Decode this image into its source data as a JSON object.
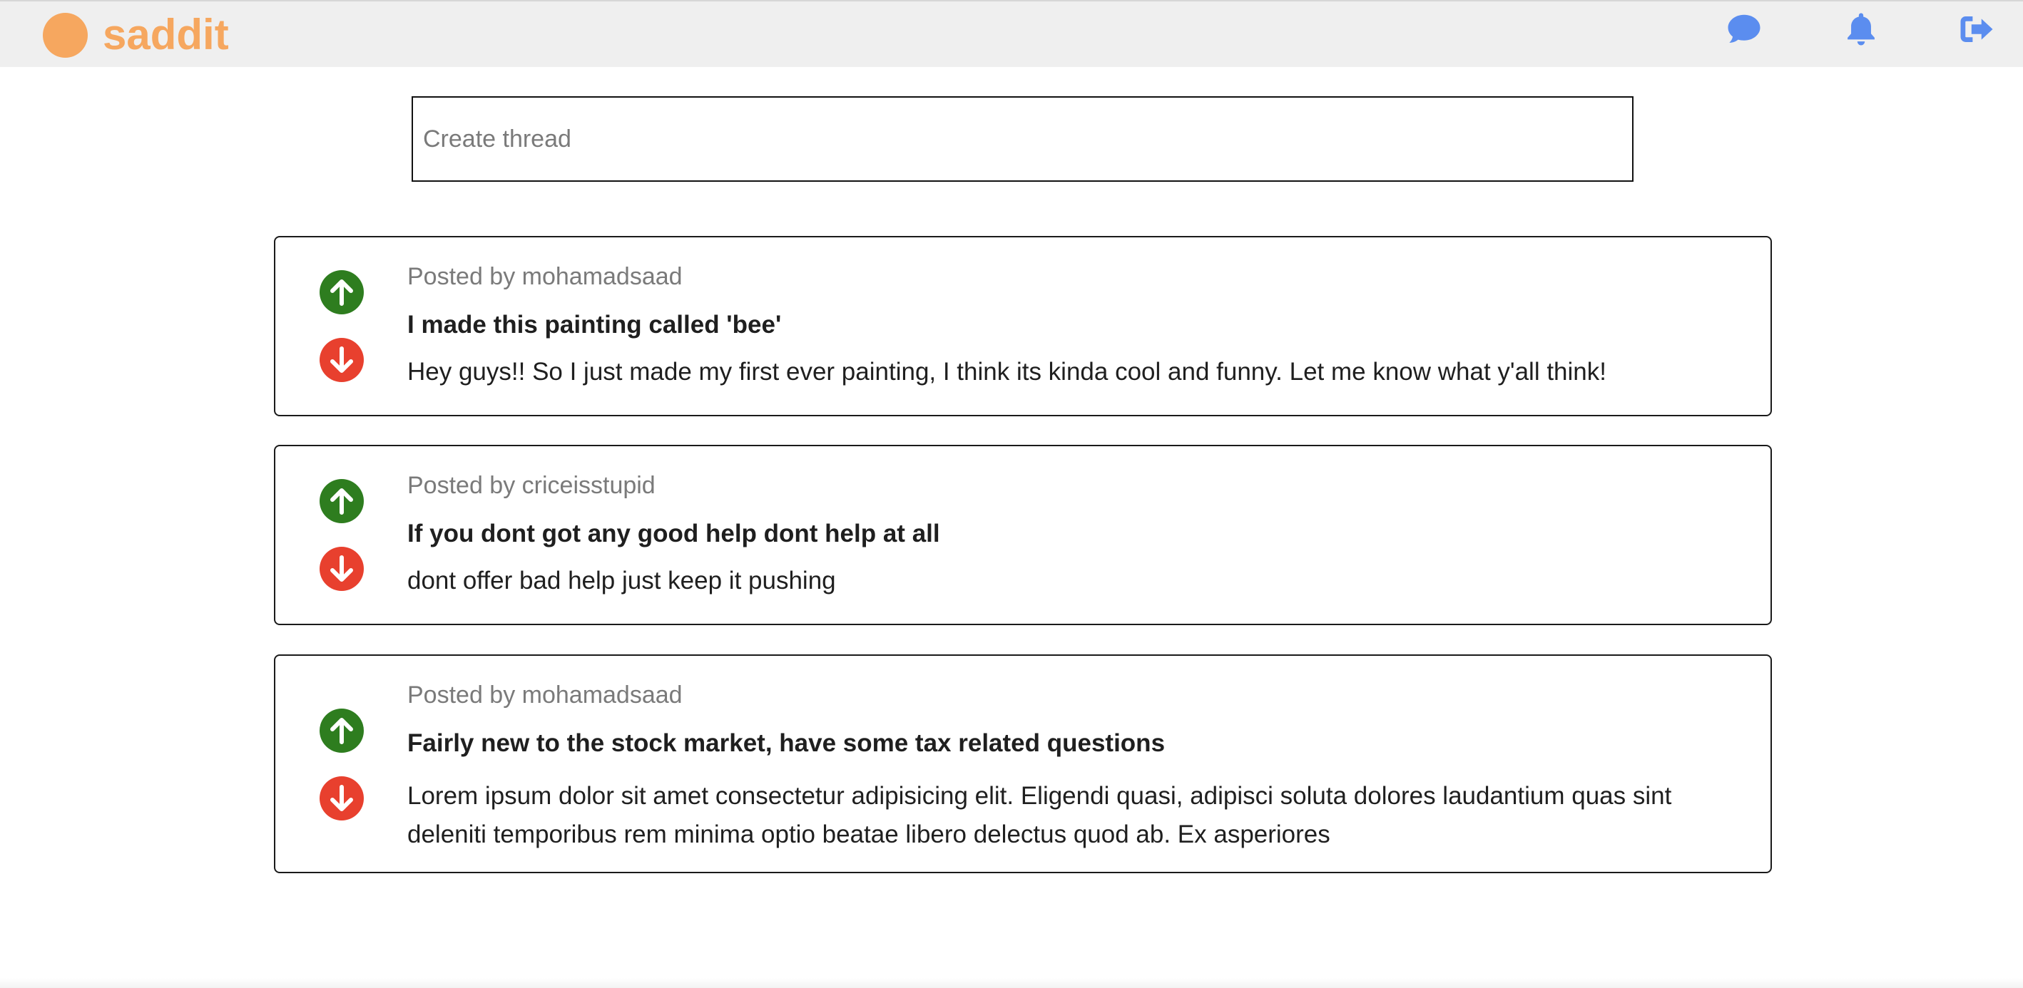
{
  "brand": {
    "name": "saddit",
    "color": "#f6a75f"
  },
  "nav": {
    "icons": [
      "chat-icon",
      "bell-icon",
      "logout-icon"
    ],
    "icon_color": "#5b8def"
  },
  "composer": {
    "placeholder": "Create thread",
    "value": ""
  },
  "colors": {
    "upvote": "#2e7d1f",
    "downvote": "#e8402e"
  },
  "posts": [
    {
      "meta": "Posted by mohamadsaad",
      "title": "I made this painting called 'bee'",
      "body": "Hey guys!! So I just made my first ever painting, I think its kinda cool and funny. Let me know what y'all think!"
    },
    {
      "meta": "Posted by criceisstupid",
      "title": "If you dont got any good help dont help at all",
      "body": "dont offer bad help just keep it pushing"
    },
    {
      "meta": "Posted by mohamadsaad",
      "title": "Fairly new to the stock market, have some tax related questions",
      "body": "Lorem ipsum dolor sit amet consectetur adipisicing elit. Eligendi quasi, adipisci soluta dolores laudantium quas sint deleniti temporibus rem minima optio beatae libero delectus quod ab. Ex asperiores"
    }
  ]
}
